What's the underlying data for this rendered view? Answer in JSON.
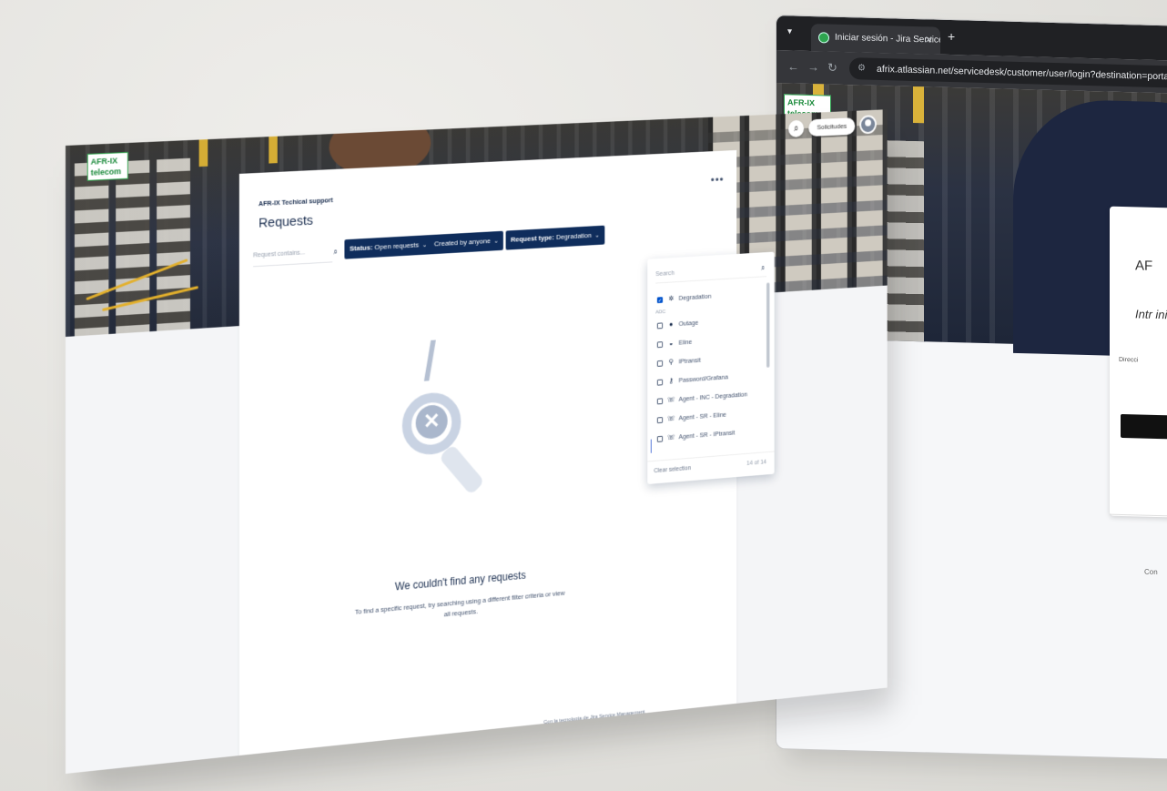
{
  "back_window": {
    "tab_title": "Iniciar sesión - Jira Service Man",
    "url": "afrix.atlassian.net/servicedesk/customer/user/login?destination=portals",
    "logo_line1": "AFR-IX",
    "logo_line2": "telecom",
    "login_heading": "AF",
    "login_intro": "Intr inic",
    "login_field_label": "Direcci",
    "footer_text": "Con"
  },
  "front_window": {
    "logo_line1": "AFR-IX",
    "logo_line2": "telecom",
    "header": {
      "search_icon": "search-icon",
      "requests_pill": "Solicitudes"
    },
    "portal_name": "AFR-IX Techical support",
    "page_title": "Requests",
    "more_label": "•••",
    "search_placeholder": "Request contains...",
    "filters": {
      "status_key": "Status:",
      "status_value": "Open requests",
      "created_by": "Created by anyone",
      "request_type_key": "Request type:",
      "request_type_value": "Degradation"
    },
    "dropdown": {
      "search_placeholder": "Search",
      "group_label": "ADC",
      "items": [
        {
          "label": "Degradation",
          "checked": true,
          "icon": "degradation-icon"
        },
        {
          "label": "Outage",
          "checked": false,
          "icon": "outage-icon"
        },
        {
          "label": "Eline",
          "checked": false,
          "icon": "eline-icon"
        },
        {
          "label": "IPtransit",
          "checked": false,
          "icon": "iptransit-icon"
        },
        {
          "label": "Password/Grafana",
          "checked": false,
          "icon": "key-icon"
        },
        {
          "label": "Agent - INC - Degradation",
          "checked": false,
          "icon": "agent-icon"
        },
        {
          "label": "Agent - SR - Eline",
          "checked": false,
          "icon": "agent-icon"
        },
        {
          "label": "Agent - SR - IPtransit",
          "checked": false,
          "icon": "agent-icon"
        }
      ],
      "clear_label": "Clear selection",
      "count_label": "14 of 14"
    },
    "empty_state": {
      "title": "We couldn't find any requests",
      "description": "To find a specific request, try searching using a different filter criteria or view all requests."
    },
    "footer": "Con la tecnología de Jira Service Management"
  }
}
